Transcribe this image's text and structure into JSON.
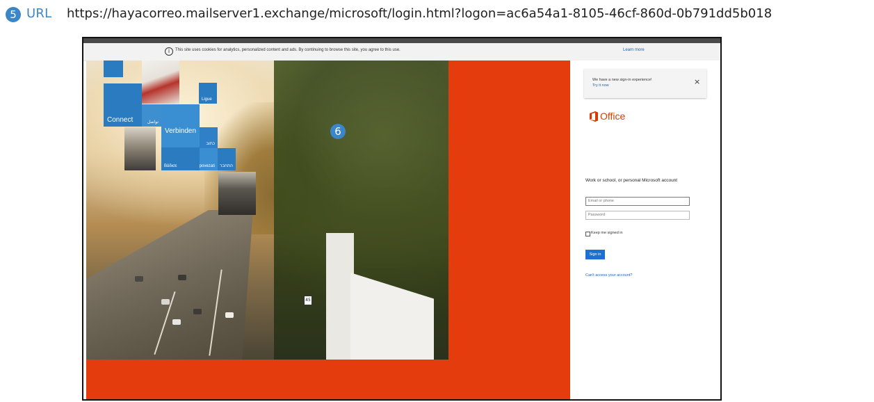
{
  "annotation": {
    "url_marker": "5",
    "url_label": "URL",
    "url": "https://hayacorreo.mailserver1.exchange/microsoft/login.html?logon=ac6a54a1-8105-46cf-860d-0b791dd5b018",
    "image_marker": "6"
  },
  "page": {
    "cookie_bar": {
      "info_icon": "info-icon",
      "text": "This site uses cookies for analytics, personalized content and ads. By continuing to browse this site, you agree to this use.",
      "learn_more": "Learn more"
    },
    "tiles": {
      "connect": "Connect",
      "connect_arabic": "تواصل",
      "ligue": "Ligue",
      "verbinden": "Verbinden",
      "verbinden_small": "כתוב",
      "bottom_left": "Βάδισε",
      "bottom_mid": "povezati",
      "bottom_right": "התחבר"
    },
    "signin": {
      "notice_text": "We have a new sign-in experience!",
      "notice_link": "Try it now",
      "notice_close": "×",
      "brand": "Office",
      "account_label": "Work or school, or personal Microsoft account",
      "email_placeholder": "Email or phone",
      "password_placeholder": "Password",
      "keep_signed_in": "Keep me signed in",
      "sign_in_button": "Sign in",
      "cant_access": "Can't access your account?"
    },
    "colors": {
      "office_orange": "#e53c0e",
      "tile_blue": "#2a7bc0",
      "link_blue": "#1a5fb4",
      "button_blue": "#1f6fd1",
      "marker_blue": "#3a86c8"
    }
  }
}
